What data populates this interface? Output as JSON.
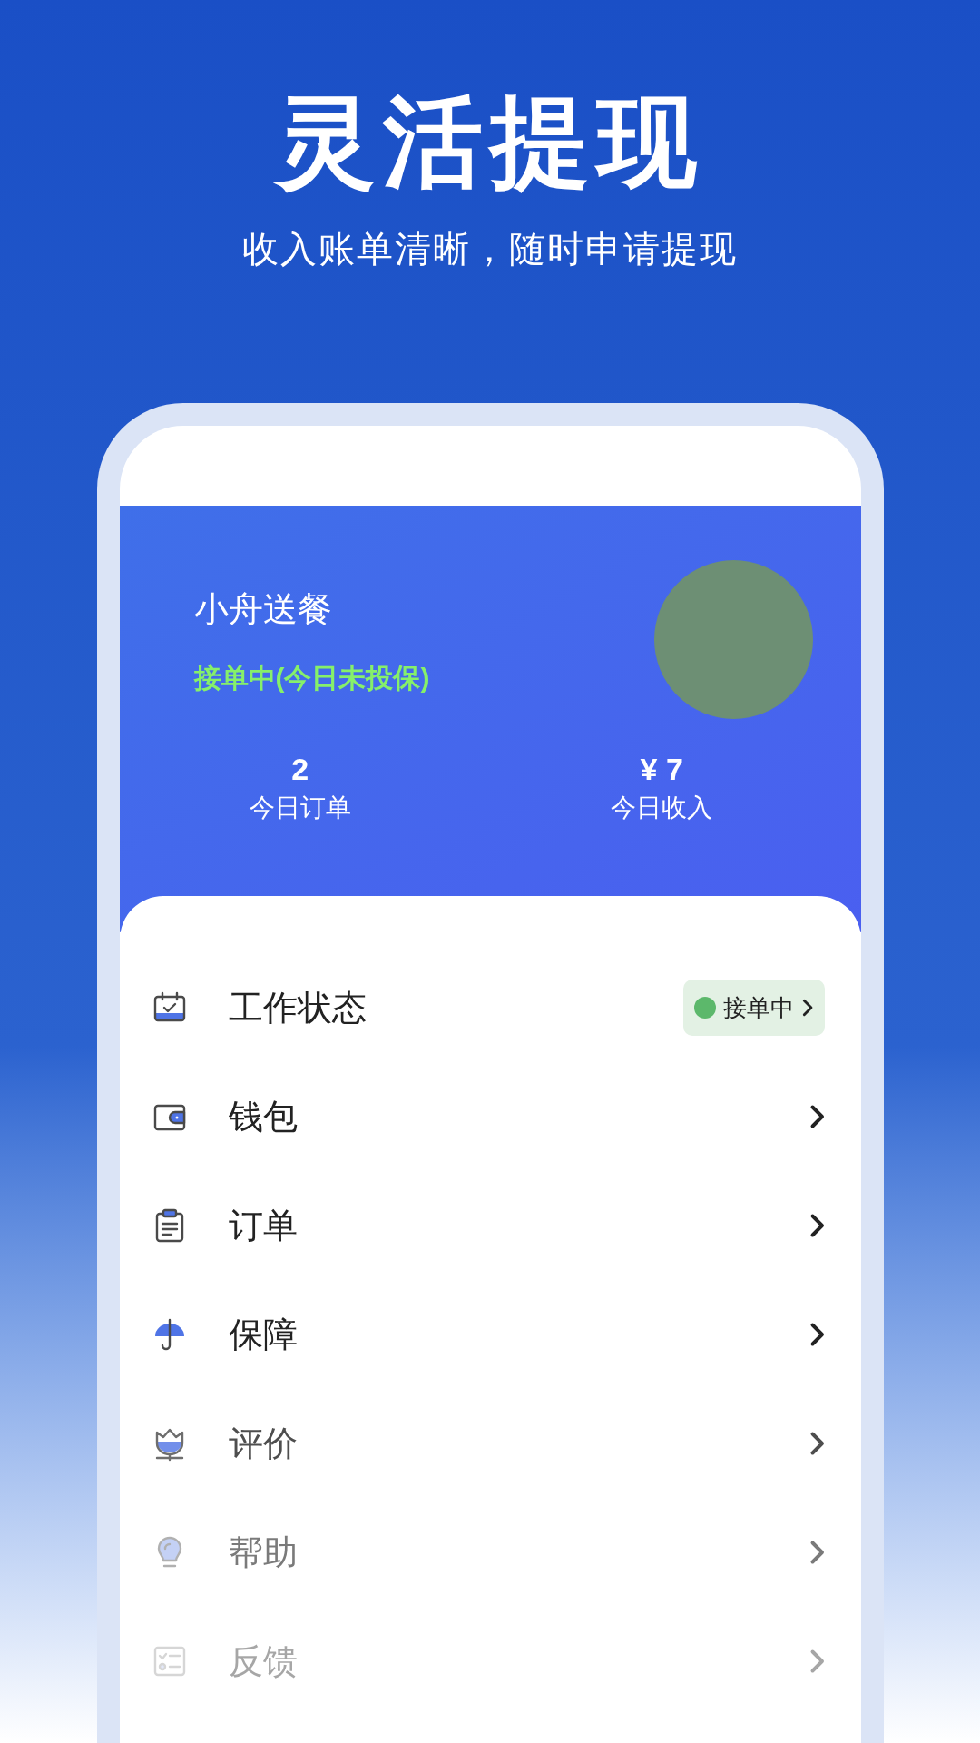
{
  "headline": {
    "title": "灵活提现",
    "subtitle": "收入账单清晰，随时申请提现"
  },
  "profile": {
    "name": "小舟送餐",
    "status": "接单中(今日未投保)"
  },
  "stats": [
    {
      "value": "2",
      "label": "今日订单"
    },
    {
      "value": "¥ 7",
      "label": "今日收入"
    }
  ],
  "menu": [
    {
      "kind": "calendar",
      "label": "工作状态",
      "badge": "接单中"
    },
    {
      "kind": "wallet",
      "label": "钱包"
    },
    {
      "kind": "clipboard",
      "label": "订单"
    },
    {
      "kind": "umbrella",
      "label": "保障"
    },
    {
      "kind": "flower",
      "label": "评价"
    },
    {
      "kind": "bulb",
      "label": "帮助"
    },
    {
      "kind": "checklist",
      "label": "反馈"
    }
  ]
}
